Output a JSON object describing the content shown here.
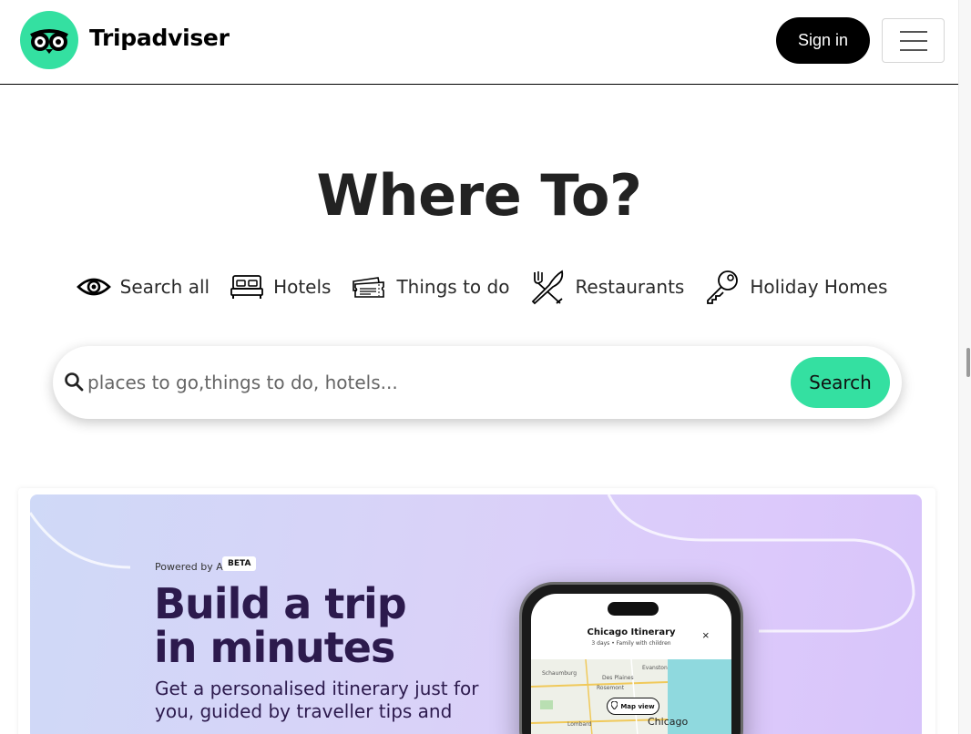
{
  "header": {
    "brand": "Tripadviser",
    "sign_in_label": "Sign in",
    "menu_icon": "hamburger-icon",
    "logo_icon": "owl-eyes-icon"
  },
  "hero": {
    "title": "Where To?"
  },
  "tabs": [
    {
      "label": "Search all",
      "icon": "eye-icon"
    },
    {
      "label": "Hotels",
      "icon": "bed-icon"
    },
    {
      "label": "Things to do",
      "icon": "ticket-icon"
    },
    {
      "label": "Restaurants",
      "icon": "fork-knife-icon"
    },
    {
      "label": "Holiday Homes",
      "icon": "key-icon"
    }
  ],
  "search": {
    "placeholder": "places to go,things to do, hotels...",
    "value": "",
    "button_label": "Search"
  },
  "banner": {
    "powered_by": "Powered by AI",
    "badge": "BETA",
    "headline_line1": "Build a trip",
    "headline_line2": "in minutes",
    "subtext": "Get a personalised itinerary just for you, guided by traveller tips and"
  },
  "phone": {
    "title": "Chicago Itinerary",
    "subtitle": "3 days • Family with children",
    "close_glyph": "×",
    "map_view_label": "Map view",
    "map_labels": [
      "Schaumburg",
      "Des Plaines",
      "Evanston",
      "Rosemont",
      "Lombard"
    ],
    "city_label": "Chicago"
  },
  "colors": {
    "brand_green": "#34e0a1",
    "headline_purple": "#2c1a4d"
  }
}
